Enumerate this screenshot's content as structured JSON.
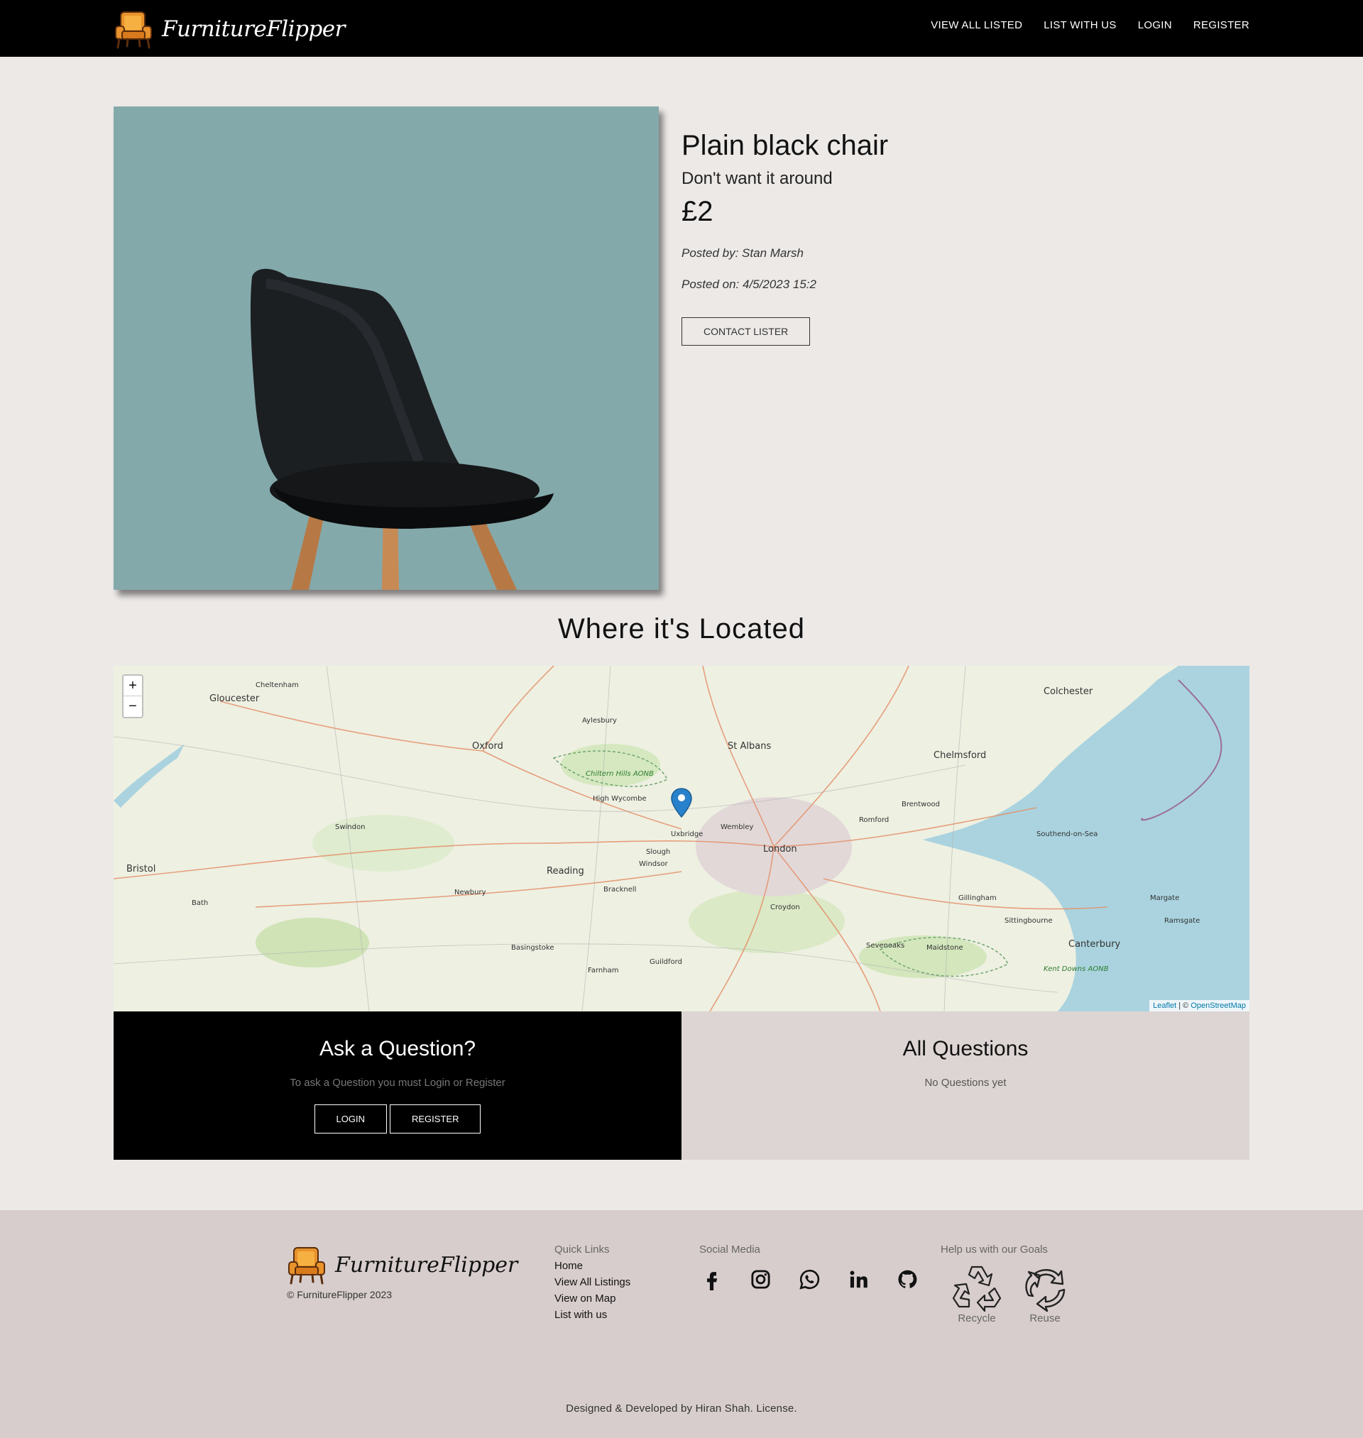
{
  "nav": {
    "brand": "FurnitureFlipper",
    "links": [
      "VIEW ALL LISTED",
      "LIST WITH US",
      "LOGIN",
      "REGISTER"
    ]
  },
  "listing": {
    "title": "Plain black chair",
    "subtitle": "Don't want it around",
    "price": "£2",
    "posted_by": "Posted by: Stan Marsh",
    "posted_on": "Posted on: 4/5/2023 15:2",
    "contact_label": "CONTACT LISTER"
  },
  "location": {
    "heading": "Where it's Located",
    "zoom_in": "+",
    "zoom_out": "−",
    "attribution_leaflet": "Leaflet",
    "attribution_sep": " | © ",
    "attribution_osm": "OpenStreetMap",
    "places": [
      "London",
      "Oxford",
      "St Albans",
      "Chelmsford",
      "Colchester",
      "Southend-on-Sea",
      "Reading",
      "Bracknell",
      "Guildford",
      "Canterbury",
      "Gloucester",
      "Bristol",
      "Bath",
      "Swindon",
      "Maidstone",
      "Margate",
      "Chiltern Hills AONB",
      "Kent Downs AONB",
      "Uxbridge",
      "Wembley",
      "Croydon",
      "Slough",
      "Windsor",
      "High Wycombe",
      "Aylesbury",
      "Newbury",
      "Basingstoke",
      "Farnham",
      "Sevenoaks",
      "Gillingham",
      "Sittingbourne",
      "Romford",
      "Brentwood",
      "Cheltenham",
      "Ramsgate"
    ]
  },
  "ask": {
    "heading": "Ask a Question?",
    "note": "To ask a Question you must Login or Register",
    "login": "LOGIN",
    "register": "REGISTER"
  },
  "all_questions": {
    "heading": "All Questions",
    "empty": "No Questions yet"
  },
  "footer": {
    "brand": "FurnitureFlipper",
    "copyright": "© FurnitureFlipper 2023",
    "quick_links_title": "Quick Links",
    "quick_links": [
      "Home",
      "View All Listings",
      "View on Map",
      "List with us"
    ],
    "social_title": "Social Media",
    "social_icons": [
      "facebook-icon",
      "instagram-icon",
      "whatsapp-icon",
      "linkedin-icon",
      "github-icon"
    ],
    "goals_title": "Help us with our Goals",
    "goals": [
      "Recycle",
      "Reuse"
    ],
    "credit": "Designed & Developed by Hiran Shah. License."
  },
  "colors": {
    "nav_bg": "#000000",
    "page_bg": "#ece9e7",
    "photo_bg": "#84a9ab",
    "questions_bg": "#ddd5d3",
    "footer_bg": "#d7cdcc",
    "marker": "#2a81cb"
  }
}
